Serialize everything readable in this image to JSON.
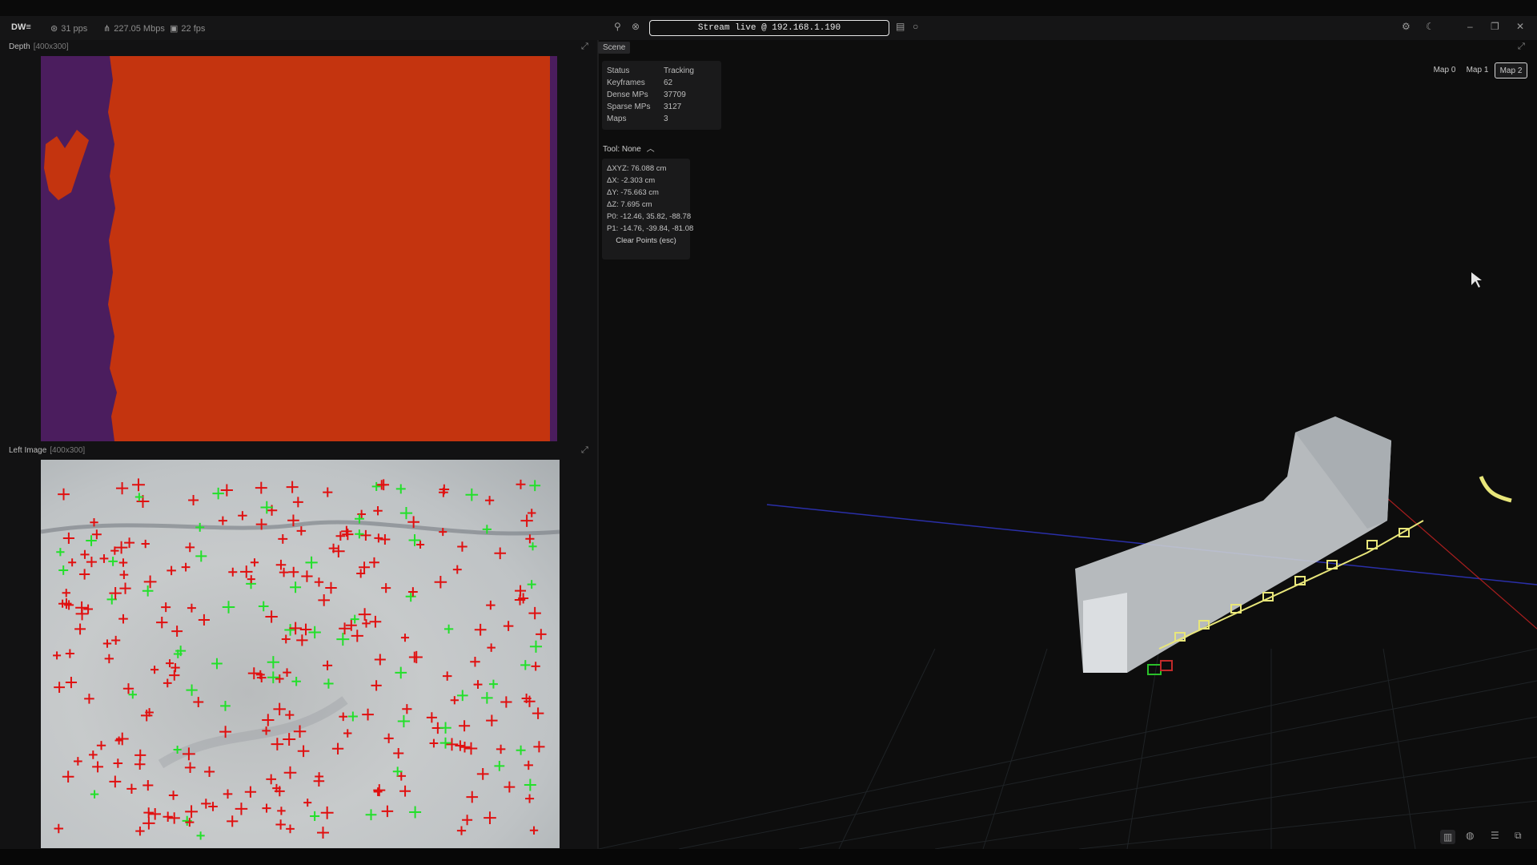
{
  "topbar": {
    "logo": "DW≡",
    "stats": [
      {
        "icon": "gauge-icon",
        "text": "31 pps"
      },
      {
        "icon": "network-icon",
        "text": "227.05 Mbps"
      },
      {
        "icon": "frame-icon",
        "text": "22 fps"
      }
    ],
    "stream_label": "Stream live @ 192.168.1.190"
  },
  "depth_panel": {
    "title": "Depth",
    "size": "[400x300]"
  },
  "left_image_panel": {
    "title": "Left Image",
    "size": "[400x300]"
  },
  "scene": {
    "tab": "Scene",
    "status": [
      {
        "label": "Status",
        "value": "Tracking"
      },
      {
        "label": "Keyframes",
        "value": "62"
      },
      {
        "label": "Dense MPs",
        "value": "37709"
      },
      {
        "label": "Sparse MPs",
        "value": "3127"
      },
      {
        "label": "Maps",
        "value": "3"
      }
    ],
    "tool_label": "Tool: None",
    "measurements": [
      "ΔXYZ: 76.088 cm",
      "ΔX: -2.303 cm",
      "ΔY: -75.663 cm",
      "ΔZ: 7.695 cm",
      "P0: -12.46, 35.82, -88.78",
      "P1: -14.76, -39.84, -81.08"
    ],
    "clear_button": "Clear Points (esc)",
    "maps": [
      "Map 0",
      "Map 1",
      "Map 2"
    ],
    "active_map": "Map 2"
  },
  "colors": {
    "depth_foreground": "#c4340f",
    "depth_background": "#4b1d5e",
    "feature_red": "#e01010",
    "feature_green": "#22e02a"
  }
}
